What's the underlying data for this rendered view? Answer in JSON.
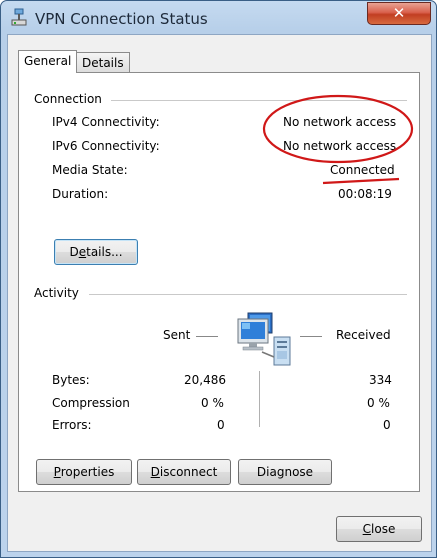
{
  "window": {
    "title": "VPN Connection Status",
    "close_glyph": "✕"
  },
  "tabs": [
    {
      "label": "General"
    },
    {
      "label": "Details"
    }
  ],
  "connection": {
    "heading": "Connection",
    "rows": [
      {
        "label": "IPv4 Connectivity:",
        "value": "No network access"
      },
      {
        "label": "IPv6 Connectivity:",
        "value": "No network access"
      },
      {
        "label": "Media State:",
        "value": "Connected"
      },
      {
        "label": "Duration:",
        "value": "00:08:19"
      }
    ],
    "details_button": {
      "pre": "D",
      "u": "e",
      "post": "tails..."
    }
  },
  "activity": {
    "heading": "Activity",
    "sent_label": "Sent",
    "received_label": "Received",
    "rows": [
      {
        "label": "Bytes:",
        "sent": "20,486",
        "received": "334"
      },
      {
        "label": "Compression",
        "sent": "0 %",
        "received": "0 %"
      },
      {
        "label": "Errors:",
        "sent": "0",
        "received": "0"
      }
    ]
  },
  "buttons": {
    "properties": {
      "u": "P",
      "post": "roperties"
    },
    "disconnect": {
      "u": "D",
      "post": "isconnect"
    },
    "diagnose": {
      "pre": "Diagnose"
    },
    "close": {
      "u": "C",
      "post": "lose"
    }
  },
  "colors": {
    "annotation_red": "#d01818",
    "title_bar": "#bcd3ec",
    "client_bg": "#f0f0f0"
  },
  "icons": [
    "network-connection-icon",
    "network-computers-icon",
    "close-icon"
  ]
}
